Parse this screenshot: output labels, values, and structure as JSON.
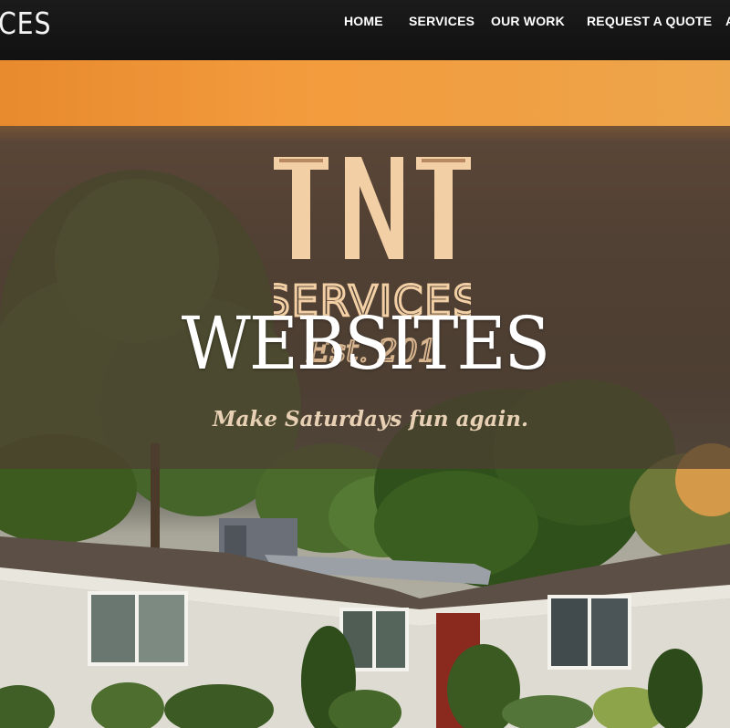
{
  "brand": {
    "name_fragment": "CES"
  },
  "nav": {
    "items": [
      {
        "label": "HOME"
      },
      {
        "label": "SERVICES"
      },
      {
        "label": "OUR WORK"
      },
      {
        "label": "REQUEST A QUOTE"
      },
      {
        "label": "A"
      }
    ]
  },
  "logo": {
    "line1": "TNT",
    "line2": "SERVICES",
    "line3": "Est. 201"
  },
  "hero": {
    "title": "WEBSITES",
    "tagline": "Make Saturdays fun again."
  },
  "colors": {
    "nav_background": "#141414",
    "sunset_orange": "#f09a3c",
    "logo_peach": "#f2cfa4",
    "overlay_brown": "#4e3e32"
  }
}
